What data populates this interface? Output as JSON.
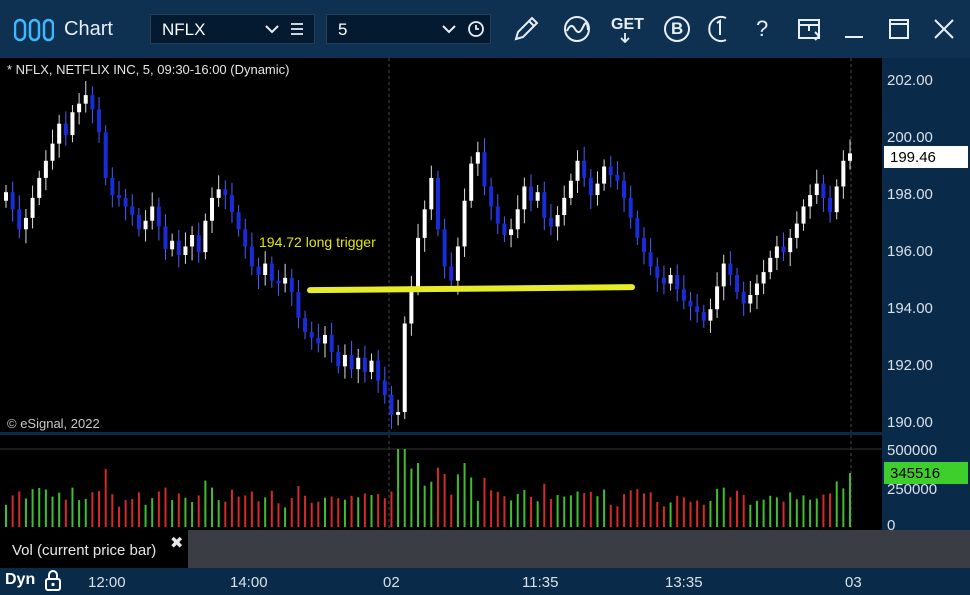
{
  "window": {
    "title": "Chart",
    "symbol": "NFLX",
    "interval": "5",
    "toolbar_get_label": "GET",
    "toolbar_b_label": "B",
    "toolbar_help_label": "?"
  },
  "chart": {
    "header": "* NFLX, NETFLIX INC, 5, 09:30-16:00 (Dynamic)",
    "annotation": "194.72 long trigger",
    "credit": "© eSignal, 2022",
    "current_price": "199.46"
  },
  "volume_panel": {
    "legend": "Vol (current price bar)",
    "close_symbol": "✖",
    "current_value": "345516",
    "axis_labels": [
      "500000",
      "250000",
      "0"
    ]
  },
  "time_axis": {
    "mode": "Dyn",
    "labels": [
      "12:00",
      "14:00",
      "02",
      "11:35",
      "13:35",
      "03"
    ]
  },
  "colors": {
    "up": "#ffffff",
    "down": "#1a2bd8",
    "trigger_line": "#e6ec2a",
    "vol_up": "#3fbf2d",
    "vol_down": "#d62a2a",
    "accent": "#0e3152"
  },
  "chart_data": {
    "type": "candlestick",
    "ylim": [
      189.7,
      202.8
    ],
    "yticks": [
      "202.00",
      "200.00",
      "198.00",
      "196.00",
      "194.00",
      "192.00",
      "190.00"
    ],
    "trigger_level": 194.72,
    "closes": [
      198.1,
      197.5,
      196.8,
      197.2,
      197.9,
      198.6,
      199.2,
      199.8,
      200.5,
      200.1,
      200.9,
      201.2,
      201.5,
      201.0,
      200.2,
      198.6,
      198.0,
      197.9,
      197.6,
      197.3,
      196.8,
      197.1,
      197.6,
      196.9,
      196.1,
      196.4,
      195.9,
      196.2,
      196.6,
      196.0,
      197.1,
      197.9,
      198.2,
      198.0,
      197.4,
      196.8,
      196.2,
      195.5,
      195.2,
      195.6,
      195.0,
      194.9,
      195.1,
      194.6,
      193.7,
      193.2,
      193.0,
      192.8,
      193.1,
      192.5,
      192.0,
      192.4,
      191.9,
      192.3,
      191.8,
      192.2,
      191.5,
      191.0,
      190.3,
      190.4,
      193.5,
      194.8,
      196.5,
      197.5,
      198.6,
      196.8,
      195.5,
      195.0,
      196.2,
      197.8,
      199.1,
      199.5,
      198.3,
      197.6,
      197.0,
      196.6,
      196.8,
      197.5,
      198.3,
      197.8,
      198.1,
      197.2,
      196.9,
      197.3,
      197.9,
      198.5,
      199.2,
      198.6,
      198.0,
      198.4,
      199.0,
      198.7,
      198.5,
      197.9,
      197.2,
      196.5,
      196.0,
      195.5,
      195.1,
      194.9,
      195.2,
      194.7,
      194.3,
      194.1,
      193.9,
      193.6,
      194.0,
      194.8,
      195.6,
      195.2,
      194.6,
      194.2,
      194.5,
      194.9,
      195.3,
      195.8,
      196.2,
      196.0,
      196.5,
      197.0,
      197.6,
      198.0,
      198.4,
      197.9,
      197.4,
      198.3,
      199.2,
      199.46
    ]
  }
}
